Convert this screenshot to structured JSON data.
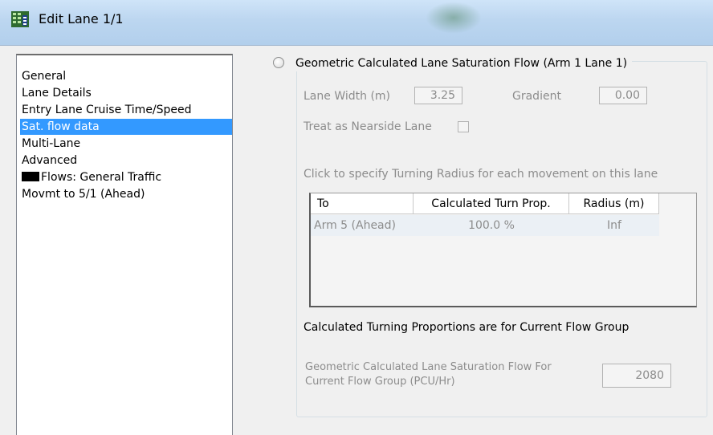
{
  "window": {
    "title": "Edit Lane 1/1",
    "icon": "app-grid-icon"
  },
  "nav": {
    "items": [
      {
        "label": "General",
        "selected": false
      },
      {
        "label": "Lane Details",
        "selected": false
      },
      {
        "label": "Entry Lane Cruise Time/Speed",
        "selected": false
      },
      {
        "label": "Sat. flow data",
        "selected": true
      },
      {
        "label": "Multi-Lane",
        "selected": false
      },
      {
        "label": "Advanced",
        "selected": false
      },
      {
        "label": "Flows: General Traffic",
        "selected": false,
        "swatch_color": "#000000"
      },
      {
        "label": "Movmt to 5/1 (Ahead)",
        "selected": false
      }
    ],
    "selected_color": "#3399ff"
  },
  "geometric": {
    "caption": "Geometric Calculated Lane Saturation Flow (Arm 1 Lane 1)",
    "selected": false,
    "lane_width_label": "Lane Width (m)",
    "lane_width_value": "3.25",
    "gradient_label": "Gradient",
    "gradient_value": "0.00",
    "nearside_label": "Treat as Nearside Lane",
    "nearside_checked": false,
    "turning_radius_hint": "Click to specify Turning Radius for each movement on this lane",
    "table": {
      "columns": [
        "To",
        "Calculated Turn Prop.",
        "Radius (m)"
      ],
      "rows": [
        [
          "Arm 5 (Ahead)",
          "100.0 %",
          "Inf"
        ]
      ]
    },
    "turning_note": "Calculated Turning Proportions are for Current Flow Group",
    "sat_flow_label_line1": "Geometric Calculated Lane Saturation Flow For",
    "sat_flow_label_line2": "Current Flow Group (PCU/Hr)",
    "sat_flow_value": "2080"
  }
}
